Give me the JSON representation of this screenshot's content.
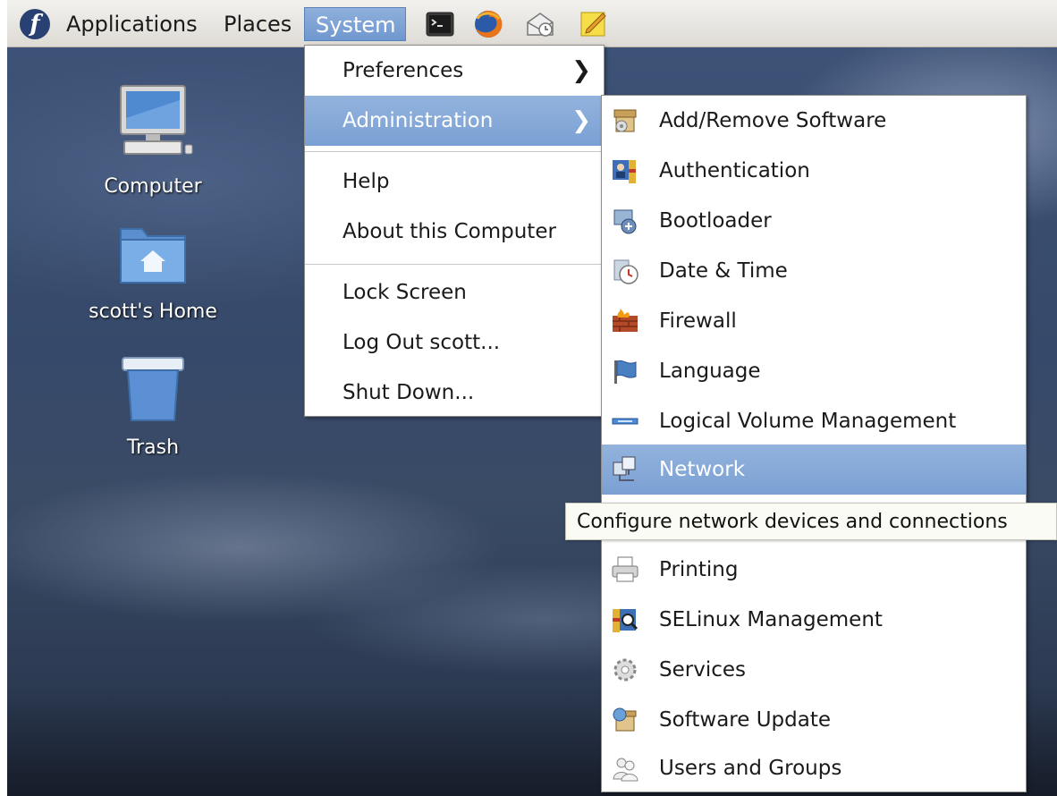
{
  "panel": {
    "applications": "Applications",
    "places": "Places",
    "system": "System",
    "launchers": [
      "terminal-icon",
      "firefox-icon",
      "mail-clock-icon",
      "notes-icon"
    ]
  },
  "desktop": {
    "icons": [
      {
        "label": "Computer",
        "icon": "computer-icon"
      },
      {
        "label": "scott's Home",
        "icon": "home-folder-icon"
      },
      {
        "label": "Trash",
        "icon": "trash-icon"
      }
    ]
  },
  "system_menu": {
    "items": [
      "Preferences",
      "Administration",
      "Help",
      "About this Computer",
      "Lock Screen",
      "Log Out scott...",
      "Shut Down..."
    ],
    "highlighted": "Administration"
  },
  "admin_menu": {
    "items": [
      {
        "label": "Add/Remove Software",
        "icon": "package-icon"
      },
      {
        "label": "Authentication",
        "icon": "authentication-icon"
      },
      {
        "label": "Bootloader",
        "icon": "bootloader-icon"
      },
      {
        "label": "Date & Time",
        "icon": "clock-icon"
      },
      {
        "label": "Firewall",
        "icon": "firewall-icon"
      },
      {
        "label": "Language",
        "icon": "flag-icon"
      },
      {
        "label": "Logical Volume Management",
        "icon": "volume-icon"
      },
      {
        "label": "Network",
        "icon": "network-icon"
      },
      {
        "label": "Printing",
        "icon": "printer-icon"
      },
      {
        "label": "SELinux Management",
        "icon": "selinux-icon"
      },
      {
        "label": "Services",
        "icon": "gear-icon"
      },
      {
        "label": "Software Update",
        "icon": "update-icon"
      },
      {
        "label": "Users and Groups",
        "icon": "users-icon"
      }
    ],
    "highlighted": "Network"
  },
  "tooltip": {
    "text": "Configure network devices and connections"
  },
  "colors": {
    "highlight": "#7aa0d3",
    "panel": "#e6e4df",
    "desktop": "#3a4d6e"
  }
}
